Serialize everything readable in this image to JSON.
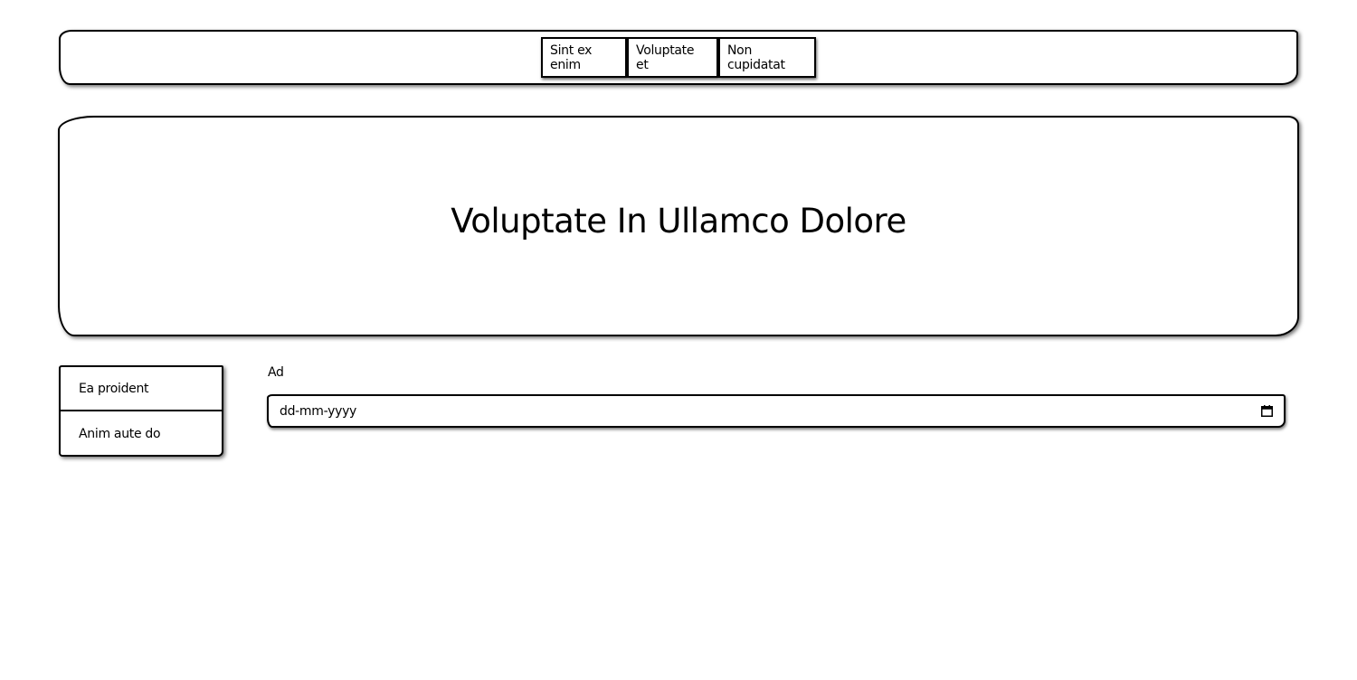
{
  "nav": {
    "items": [
      {
        "label": "Sint ex enim"
      },
      {
        "label": "Voluptate et"
      },
      {
        "label": "Non cupidatat"
      }
    ]
  },
  "hero": {
    "title": "Voluptate In Ullamco Dolore"
  },
  "sidebar": {
    "items": [
      {
        "label": "Ea proident"
      },
      {
        "label": "Anim aute do"
      }
    ]
  },
  "form": {
    "date_label": "Ad",
    "date_placeholder": "dd-mm-yyyy",
    "date_icon": "calendar-icon"
  }
}
